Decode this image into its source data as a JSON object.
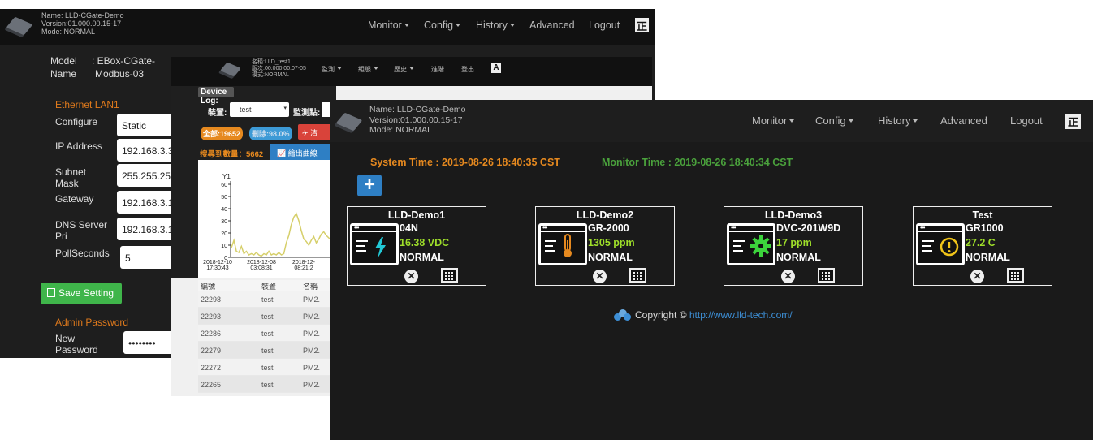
{
  "window1": {
    "device": {
      "name": "Name:  LLD-CGate-Demo",
      "version": "Version:01.000.00.15-17",
      "mode": "Mode:  NORMAL"
    },
    "nav": {
      "monitor": "Monitor",
      "config": "Config",
      "history": "History",
      "advanced": "Advanced",
      "logout": "Logout",
      "lang": "正"
    },
    "model_label": "Model",
    "model_value": ": EBox-CGate-",
    "name_label": "Name",
    "name_value": "Modbus-03",
    "ethernet_section": "Ethernet LAN1",
    "fields": {
      "configure": {
        "label": "Configure",
        "value": "Static"
      },
      "ip": {
        "label": "IP Address",
        "value": "192.168.3.3"
      },
      "subnet": {
        "label1": "Subnet",
        "label2": "Mask",
        "value": "255.255.255"
      },
      "gateway": {
        "label": "Gateway",
        "value": "192.168.3.1"
      },
      "dns": {
        "label1": "DNS Server",
        "label2": "Pri",
        "value": "192.168.3.1"
      },
      "poll": {
        "label": "PollSeconds",
        "value": "5"
      }
    },
    "save_button": "Save Setting",
    "admin_section": "Admin Password",
    "new_password_label1": "New",
    "new_password_label2": "Password",
    "new_password_value": "••••••••"
  },
  "window2": {
    "device": {
      "name": "名稱:LLD_test1",
      "version": "版次:00.000.00.07-05",
      "mode": "模式:NORMAL"
    },
    "nav": {
      "monitor": "監測",
      "config": "組態",
      "history": "歷史",
      "advanced": "進階",
      "logout": "登出",
      "lang": "A"
    },
    "device_log": "Device Log:",
    "device_label": "裝置:",
    "device_value": "test",
    "point_label": "監測點:",
    "total_tag": "全部:19652",
    "percent_tag": "刪除:98.0%",
    "clear_button": "清",
    "search_count": "搜尋到數量：5662",
    "draw_button": "繪出曲線",
    "chart_data": {
      "type": "line",
      "title": "",
      "xlabel": "",
      "ylabel": "Y1",
      "ylim": [
        0,
        60
      ],
      "yticks": [
        0,
        10,
        20,
        30,
        40,
        50,
        60
      ],
      "xtick_labels": [
        [
          "2018-12-10",
          "17:30:43"
        ],
        [
          "2018-12-08",
          "03:08:31"
        ],
        [
          "2018-12-",
          "08:21:2"
        ]
      ],
      "series": [
        {
          "values": [
            8,
            14,
            5,
            4,
            9,
            3,
            5,
            2,
            3,
            2,
            4,
            2,
            1,
            3,
            2,
            5,
            2,
            3,
            2,
            4,
            2,
            3,
            12,
            18,
            27,
            33,
            36,
            30,
            22,
            15,
            13,
            10,
            14,
            17,
            12,
            15,
            19,
            21,
            18,
            16,
            14,
            18
          ]
        }
      ]
    },
    "table": {
      "headers": [
        "編號",
        "裝置",
        "名稱"
      ],
      "rows": [
        [
          "22298",
          "test",
          "PM2."
        ],
        [
          "22293",
          "test",
          "PM2."
        ],
        [
          "22286",
          "test",
          "PM2."
        ],
        [
          "22279",
          "test",
          "PM2."
        ],
        [
          "22272",
          "test",
          "PM2."
        ],
        [
          "22265",
          "test",
          "PM2."
        ]
      ]
    }
  },
  "window3": {
    "device": {
      "name": "Name:  LLD-CGate-Demo",
      "version": "Version:01.000.00.15-17",
      "mode": "Mode:  NORMAL"
    },
    "nav": {
      "monitor": "Monitor",
      "config": "Config",
      "history": "History",
      "advanced": "Advanced",
      "logout": "Logout",
      "lang": "正"
    },
    "system_time": "System Time : 2019-08-26 18:40:35 CST",
    "monitor_time": "Monitor Time : 2019-08-26 18:40:34 CST",
    "add_button": "+",
    "cards": [
      {
        "title": "LLD-Demo1",
        "model": "04N",
        "value": "16.38  VDC",
        "status": "NORMAL",
        "icon": "lightning-icon"
      },
      {
        "title": "LLD-Demo2",
        "model": "GR-2000",
        "value": "1305  ppm",
        "status": "NORMAL",
        "icon": "thermometer-icon"
      },
      {
        "title": "LLD-Demo3",
        "model": "DVC-201W9D",
        "value": "17  ppm",
        "status": "NORMAL",
        "icon": "gear-icon"
      },
      {
        "title": "Test",
        "model": "GR1000",
        "value": "27.2  C",
        "status": "NORMAL",
        "icon": "warning-icon"
      }
    ],
    "copyright_text": "Copyright © ",
    "copyright_link": "http://www.lld-tech.com/",
    "colors": {
      "accent_orange": "#e6891f",
      "accent_green": "#4aa13c",
      "value_green": "#9ede2a",
      "button_blue": "#2e7fc4"
    }
  }
}
